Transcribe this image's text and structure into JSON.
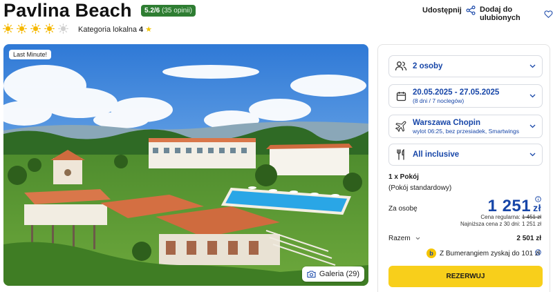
{
  "hotel": {
    "name": "Pavlina Beach",
    "rating_score": "5.2/6",
    "rating_count": "(35 opinii)",
    "sun_rating": 4,
    "sun_max": 5,
    "category_label": "Kategoria lokalna",
    "category_value": "4"
  },
  "actions": {
    "share_label": "Udostępnij",
    "favorite_label": "Dodaj do ulubionych"
  },
  "photo": {
    "badge": "Last Minute!",
    "gallery_label": "Galeria (29)"
  },
  "booking": {
    "guests": {
      "main": "2 osoby"
    },
    "dates": {
      "main": "20.05.2025 - 27.05.2025",
      "sub": "(8 dni / 7 noclegów)"
    },
    "flight": {
      "main": "Warszawa Chopin",
      "sub": "wylot 06:25, bez przesiadek, Smartwings"
    },
    "board": {
      "main": "All inclusive"
    },
    "room_count": "1 x Pokój",
    "room_type": "(Pokój standardowy)",
    "per_person_label": "Za osobę",
    "price": "1 251",
    "currency": "zł",
    "regular_label": "Cena regularna:",
    "regular_price": "1 451 zł",
    "lowest_label": "Najniższa cena z 30 dni: 1 251 zł",
    "total_label": "Razem",
    "total_value": "2 501 zł",
    "bumerang_text": "Z Bumerangiem zyskaj do 101 zł",
    "reserve_label": "REZERWUJ"
  },
  "colors": {
    "brand_blue": "#1746a8",
    "rating_green": "#2e7d32",
    "cta_yellow": "#f8cf1b",
    "sun_active": "#f5b800",
    "sun_inactive": "#d0d0d0"
  }
}
